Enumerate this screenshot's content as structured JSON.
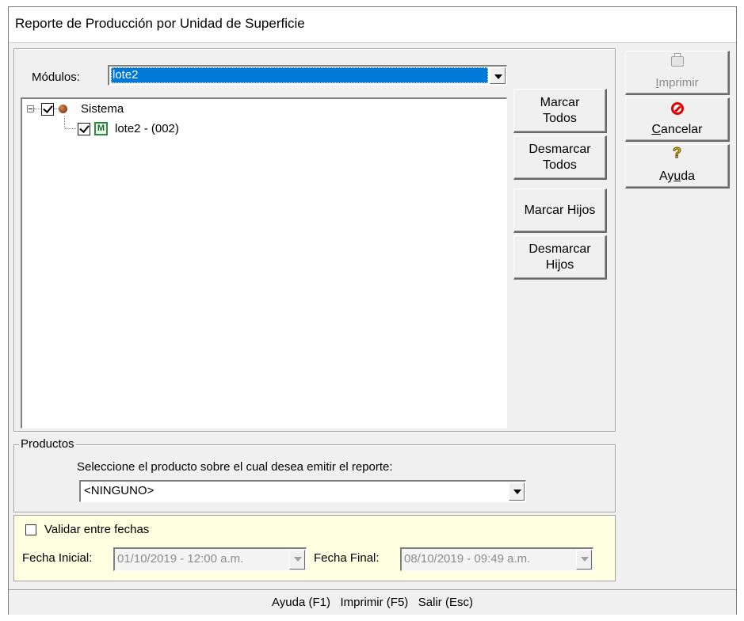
{
  "window": {
    "title": "Reporte de Producción por Unidad de Superficie"
  },
  "modulos": {
    "label": "Módulos:",
    "selected": "lote2"
  },
  "tree": {
    "root": {
      "label": "Sistema",
      "checked": true,
      "expanded": true
    },
    "children": [
      {
        "label": "lote2 - (002)",
        "checked": true
      }
    ]
  },
  "side_buttons": {
    "marcar_todos": [
      "Marcar",
      "Todos"
    ],
    "desmarcar_todos": [
      "Desmarcar",
      "Todos"
    ],
    "marcar_hijos": "Marcar Hijos",
    "desmarcar_hijos": [
      "Desmarcar",
      "Hijos"
    ]
  },
  "actions": {
    "imprimir": {
      "pre": "",
      "ul": "I",
      "post": "mprimir",
      "enabled": false
    },
    "cancelar": {
      "pre": "",
      "ul": "C",
      "post": "ancelar",
      "enabled": true
    },
    "ayuda": {
      "pre": "Ay",
      "ul": "u",
      "post": "da",
      "enabled": true
    }
  },
  "productos": {
    "group_label": "Productos",
    "prompt": "Seleccione el producto sobre el cual desea emitir el reporte:",
    "selected": "<NINGUNO>"
  },
  "fechas": {
    "validar_label": "Validar entre fechas",
    "validar_checked": false,
    "inicial_label": "Fecha Inicial:",
    "inicial_value": "01/10/2019 - 12:00 a.m.",
    "final_label": "Fecha Final:",
    "final_value": "08/10/2019 - 09:49 a.m."
  },
  "status_bar": {
    "text": "Ayuda (F1)   Imprimir (F5)   Salir (Esc)"
  },
  "colors": {
    "selection": "#0078d7",
    "date_panel": "#ffffe1",
    "cancel_icon": "#e00000",
    "help_icon": "#e8c000"
  }
}
